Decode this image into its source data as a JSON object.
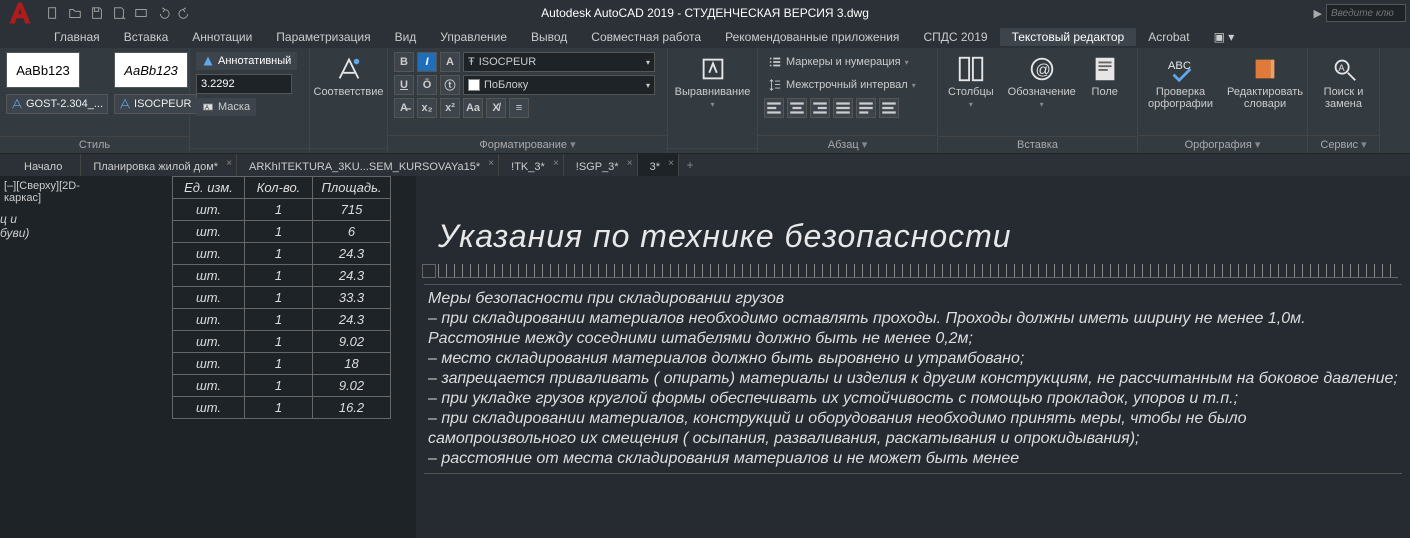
{
  "title": "Autodesk AutoCAD 2019 - СТУДЕНЧЕСКАЯ ВЕРСИЯ   3.dwg",
  "search_placeholder": "Введите клю",
  "menubar": [
    "Главная",
    "Вставка",
    "Аннотации",
    "Параметризация",
    "Вид",
    "Управление",
    "Вывод",
    "Совместная работа",
    "Рекомендованные приложения",
    "СПДС 2019",
    "Текстовый редактор",
    "Acrobat"
  ],
  "menubar_active": 10,
  "ribbon": {
    "style": {
      "sample1": "AaBb123",
      "sample2": "AaBb123",
      "name1": "GOST-2.304_...",
      "name2": "ISOCPEUR",
      "annotative": "Аннотативный",
      "height": "3.2292",
      "mask": "Маска",
      "title": "Стиль"
    },
    "match": {
      "label": "Соответствие"
    },
    "format": {
      "title": "Форматирование",
      "font": "ISOCPEUR",
      "layer": "ПоБлоку"
    },
    "justify": {
      "label": "Выравнивание"
    },
    "paragraph": {
      "title": "Абзац",
      "bullets": "Маркеры и нумерация",
      "linespace": "Межстрочный интервал"
    },
    "insert": {
      "title": "Вставка",
      "columns": "Столбцы",
      "symbol": "Обозначение",
      "field": "Поле"
    },
    "spellcheck": {
      "title": "Орфография",
      "check": "Проверка орфографии",
      "dict": "Редактировать словари"
    },
    "tools": {
      "title": "Сервис",
      "findreplace": "Поиск и замена"
    }
  },
  "filetabs": [
    {
      "label": "Начало",
      "close": false
    },
    {
      "label": "Планировка жилой дом*",
      "close": true
    },
    {
      "label": "ARKhITEKTURA_3KU...SEM_KURSOVAYa15*",
      "close": true
    },
    {
      "label": "!TK_3*",
      "close": true
    },
    {
      "label": "!SGP_3*",
      "close": true
    },
    {
      "label": "3*",
      "close": true
    }
  ],
  "filetab_active": 5,
  "view_label": "[–][Сверху][2D-каркас]",
  "side_fragments": [
    "ц и",
    "буви)"
  ],
  "table": {
    "headers": [
      "Ед. изм.",
      "Кол-во.",
      "Площадь."
    ],
    "rows": [
      [
        "шт.",
        "1",
        "715"
      ],
      [
        "шт.",
        "1",
        "6"
      ],
      [
        "шт.",
        "1",
        "24.3"
      ],
      [
        "шт.",
        "1",
        "24.3"
      ],
      [
        "шт.",
        "1",
        "33.3"
      ],
      [
        "шт.",
        "1",
        "24.3"
      ],
      [
        "шт.",
        "1",
        "9.02"
      ],
      [
        "шт.",
        "1",
        "18"
      ],
      [
        "шт.",
        "1",
        "9.02"
      ],
      [
        "шт.",
        "1",
        "16.2"
      ]
    ]
  },
  "mtext": {
    "title": "Указания по технике безопасности",
    "lines": [
      "Меры безопасности при складировании грузов",
      "–    при складировании материалов необходимо оставлять проходы. Проходы должны иметь ширину не менее 1,0м. Расстояние между соседними штабелями должно быть не менее 0,2м;",
      "–    место складирования материалов должно быть выровнено и утрамбовано;",
      "–    запрещается приваливать ( опирать) материалы и изделия к другим конструкциям, не рассчитанным на боковое давление;",
      "–    при укладке грузов круглой формы обеспечивать их устойчивость с помощью прокладок, упоров и т.п.;",
      "–    при складировании материалов, конструкций и оборудования необходимо принять меры, чтобы не было самопроизвольного их смещения ( осыпания, разваливания, раскатывания и опрокидывания);",
      "–    расстояние от места складирования материалов и не может быть менее"
    ]
  }
}
